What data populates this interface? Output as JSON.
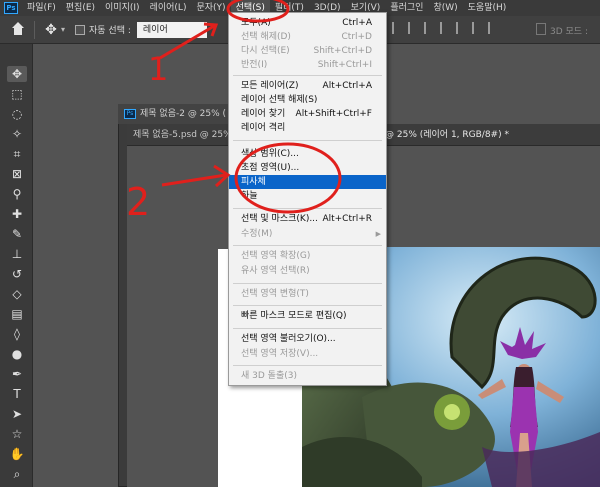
{
  "app": {
    "logo": "Ps"
  },
  "menubar": {
    "items": [
      "파일(F)",
      "편집(E)",
      "이미지(I)",
      "레이어(L)",
      "문자(Y)",
      "선택(S)",
      "필터(T)",
      "3D(D)",
      "보기(V)",
      "플러그인",
      "창(W)",
      "도움말(H)"
    ]
  },
  "options": {
    "auto_select_label": "자동 선택 :",
    "auto_select_value": "레이어",
    "mode3d_label": "3D 모드 :"
  },
  "tabs": {
    "front_window_title": "제목 없음-2 @ 25% (",
    "back_tab_left": "제목 없음-5.psd @ 25% (",
    "back_tab_right": "@ 25% (레이어 1, RGB/8#) *"
  },
  "select_menu": {
    "items": [
      {
        "label": "모두(A)",
        "shortcut": "Ctrl+A",
        "enabled": true
      },
      {
        "label": "선택 해제(D)",
        "shortcut": "Ctrl+D",
        "enabled": false
      },
      {
        "label": "다시 선택(E)",
        "shortcut": "Shift+Ctrl+D",
        "enabled": false
      },
      {
        "label": "반전(I)",
        "shortcut": "Shift+Ctrl+I",
        "enabled": false
      },
      {
        "label": "모든 레이어(Z)",
        "shortcut": "Alt+Ctrl+A",
        "enabled": true
      },
      {
        "label": "레이어 선택 해제(S)",
        "shortcut": "",
        "enabled": true
      },
      {
        "label": "레이어 찾기",
        "shortcut": "Alt+Shift+Ctrl+F",
        "enabled": true
      },
      {
        "label": "레이어 격리",
        "shortcut": "",
        "enabled": true
      },
      {
        "label": "색상 범위(C)...",
        "shortcut": "",
        "enabled": true
      },
      {
        "label": "초점 영역(U)...",
        "shortcut": "",
        "enabled": true
      },
      {
        "label": "피사체",
        "shortcut": "",
        "enabled": true,
        "highlighted": true
      },
      {
        "label": "하늘",
        "shortcut": "",
        "enabled": true
      },
      {
        "label": "선택 및 마스크(K)...",
        "shortcut": "Alt+Ctrl+R",
        "enabled": true
      },
      {
        "label": "수정(M)",
        "shortcut": "",
        "enabled": false,
        "submenu": true
      },
      {
        "label": "선택 영역 확장(G)",
        "shortcut": "",
        "enabled": false
      },
      {
        "label": "유사 영역 선택(R)",
        "shortcut": "",
        "enabled": false
      },
      {
        "label": "선택 영역 변형(T)",
        "shortcut": "",
        "enabled": false
      },
      {
        "label": "빠른 마스크 모드로 편집(Q)",
        "shortcut": "",
        "enabled": true
      },
      {
        "label": "선택 영역 불러오기(O)...",
        "shortcut": "",
        "enabled": true
      },
      {
        "label": "선택 영역 저장(V)...",
        "shortcut": "",
        "enabled": false
      },
      {
        "label": "새 3D 돌출(3)",
        "shortcut": "",
        "enabled": false
      }
    ]
  },
  "annotations": {
    "step1": "1",
    "step2": "2"
  },
  "colors": {
    "highlight": "#0a64c9",
    "annotation": "#e0201c",
    "ps_blue": "#31a8ff"
  }
}
